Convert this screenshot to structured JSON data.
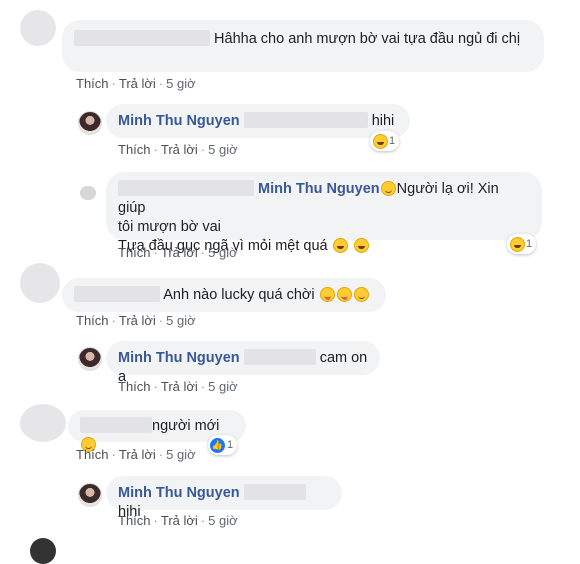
{
  "comments": [
    {
      "text": "Hâhha cho anh mượn bờ vai tựa đầu ngủ đi chị",
      "actions": {
        "like": "Thích",
        "reply": "Trả lời",
        "time": "5 giờ"
      }
    },
    {
      "name": "Minh Thu Nguyen",
      "text": "hihi",
      "reaction_count": "1",
      "reaction_icon": "laughing-emoji-icon",
      "actions": {
        "like": "Thích",
        "reply": "Trả lời",
        "time": "5 giờ"
      }
    },
    {
      "name": "Minh Thu Nguyen",
      "text_line1": "Người lạ ơi! Xin giúp",
      "text_line2": "tôi mượn bờ vai",
      "text_line3": "Tựa đầu gục ngã vì mỏi mệt quá",
      "reaction_count": "1",
      "reaction_icon": "laughing-emoji-icon",
      "actions": {
        "like": "Thích",
        "reply": "Trả lời",
        "time": "5 giờ"
      }
    },
    {
      "text": "Anh nào lucky quá chời",
      "actions": {
        "like": "Thích",
        "reply": "Trả lời",
        "time": "5 giờ"
      }
    },
    {
      "name": "Minh Thu Nguyen",
      "text": "cam on a",
      "actions": {
        "like": "Thích",
        "reply": "Trả lời",
        "time": "5 giờ"
      }
    },
    {
      "text": "người mới",
      "reaction_count": "1",
      "reaction_icon": "like-icon",
      "actions": {
        "like": "Thích",
        "reply": "Trả lời",
        "time": "5 giờ"
      }
    },
    {
      "name": "Minh Thu Nguyen",
      "text": "hihi",
      "actions": {
        "like": "Thích",
        "reply": "Trả lời",
        "time": "5 giờ"
      }
    }
  ],
  "colors": {
    "name": "#385898",
    "bubble": "#f2f3f5",
    "meta": "#606770"
  }
}
